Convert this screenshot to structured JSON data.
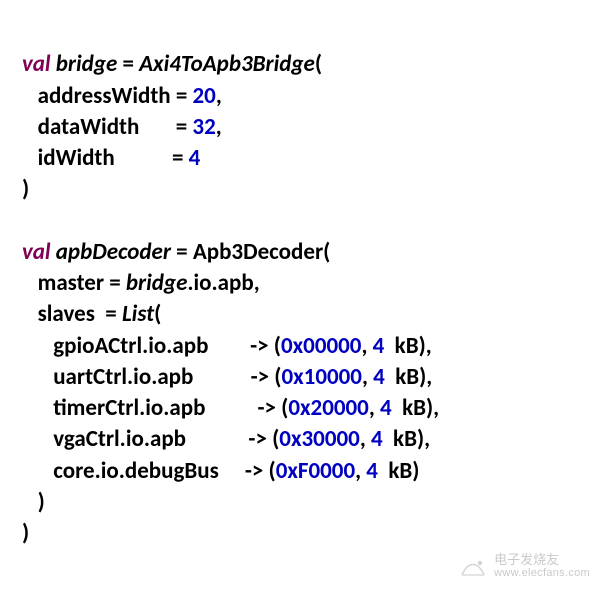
{
  "kw_val": "val",
  "bridge_name": "bridge",
  "ctor_bridge": "Axi4ToApb3Bridge",
  "p_addressWidth": "addressWidth",
  "p_dataWidth": "dataWidth",
  "p_idWidth": "idWidth",
  "v_addressWidth": "20",
  "v_dataWidth": "32",
  "v_idWidth": "4",
  "decoder_name": "apbDecoder",
  "ctor_decoder": "Apb3Decoder",
  "p_master": "master",
  "p_slaves": "slaves",
  "list_ctor": "List",
  "io_apb_suffix": ".io.apb",
  "io_debug_suffix": ".io.debugBus",
  "slaves": [
    {
      "obj": "gpioACtrl",
      "suffix": ".io.apb",
      "pad": "        ",
      "addr": "0x00000",
      "size": "4",
      "unit": "kB",
      "trail_comma": ","
    },
    {
      "obj": "uartCtrl",
      "suffix": ".io.apb",
      "pad": "           ",
      "addr": "0x10000",
      "size": "4",
      "unit": "kB",
      "trail_comma": ","
    },
    {
      "obj": "timerCtrl",
      "suffix": ".io.apb",
      "pad": "          ",
      "addr": "0x20000",
      "size": "4",
      "unit": "kB",
      "trail_comma": ","
    },
    {
      "obj": "vgaCtrl",
      "suffix": ".io.apb",
      "pad": "            ",
      "addr": "0x30000",
      "size": "4",
      "unit": "kB",
      "trail_comma": ","
    },
    {
      "obj": "core",
      "suffix": ".io.debugBus",
      "pad": "     ",
      "addr": "0xF0000",
      "size": "4",
      "unit": "kB",
      "trail_comma": ""
    }
  ],
  "watermark_cn": "电子发烧友",
  "watermark_url": "www.elecfans.com"
}
